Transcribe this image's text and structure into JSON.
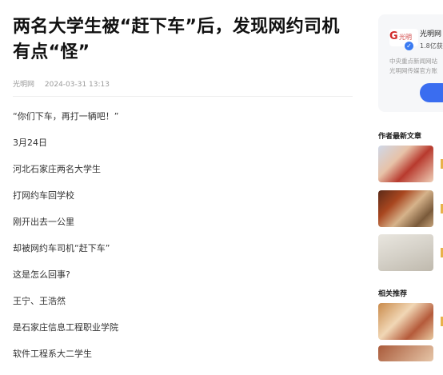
{
  "article": {
    "title": "两名大学生被“赶下车”后，发现网约司机有点“怪”",
    "source": "光明网",
    "date": "2024-03-31 13:13",
    "paragraphs": [
      "“你们下车，再打一辆吧！”",
      "3月24日",
      "河北石家庄两名大学生",
      "打网约车回学校",
      "刚开出去一公里",
      "却被网约车司机“赶下车”",
      "这是怎么回事?",
      "王宁、王浩然",
      "是石家庄信息工程职业学院",
      "软件工程系大二学生"
    ]
  },
  "sidebar": {
    "account": {
      "name": "光明网",
      "fans": "1.8亿获",
      "desc_line1": "中央重点新闻网站",
      "desc_line2": "光明网传媒官方账",
      "logo_text": "光明"
    },
    "author_section_title": "作者最新文章",
    "related_section_title": "相关推荐"
  },
  "colors": {
    "accent": "#3a6df0",
    "verified": "#3a7bf2",
    "logo_red": "#d02b2b"
  }
}
